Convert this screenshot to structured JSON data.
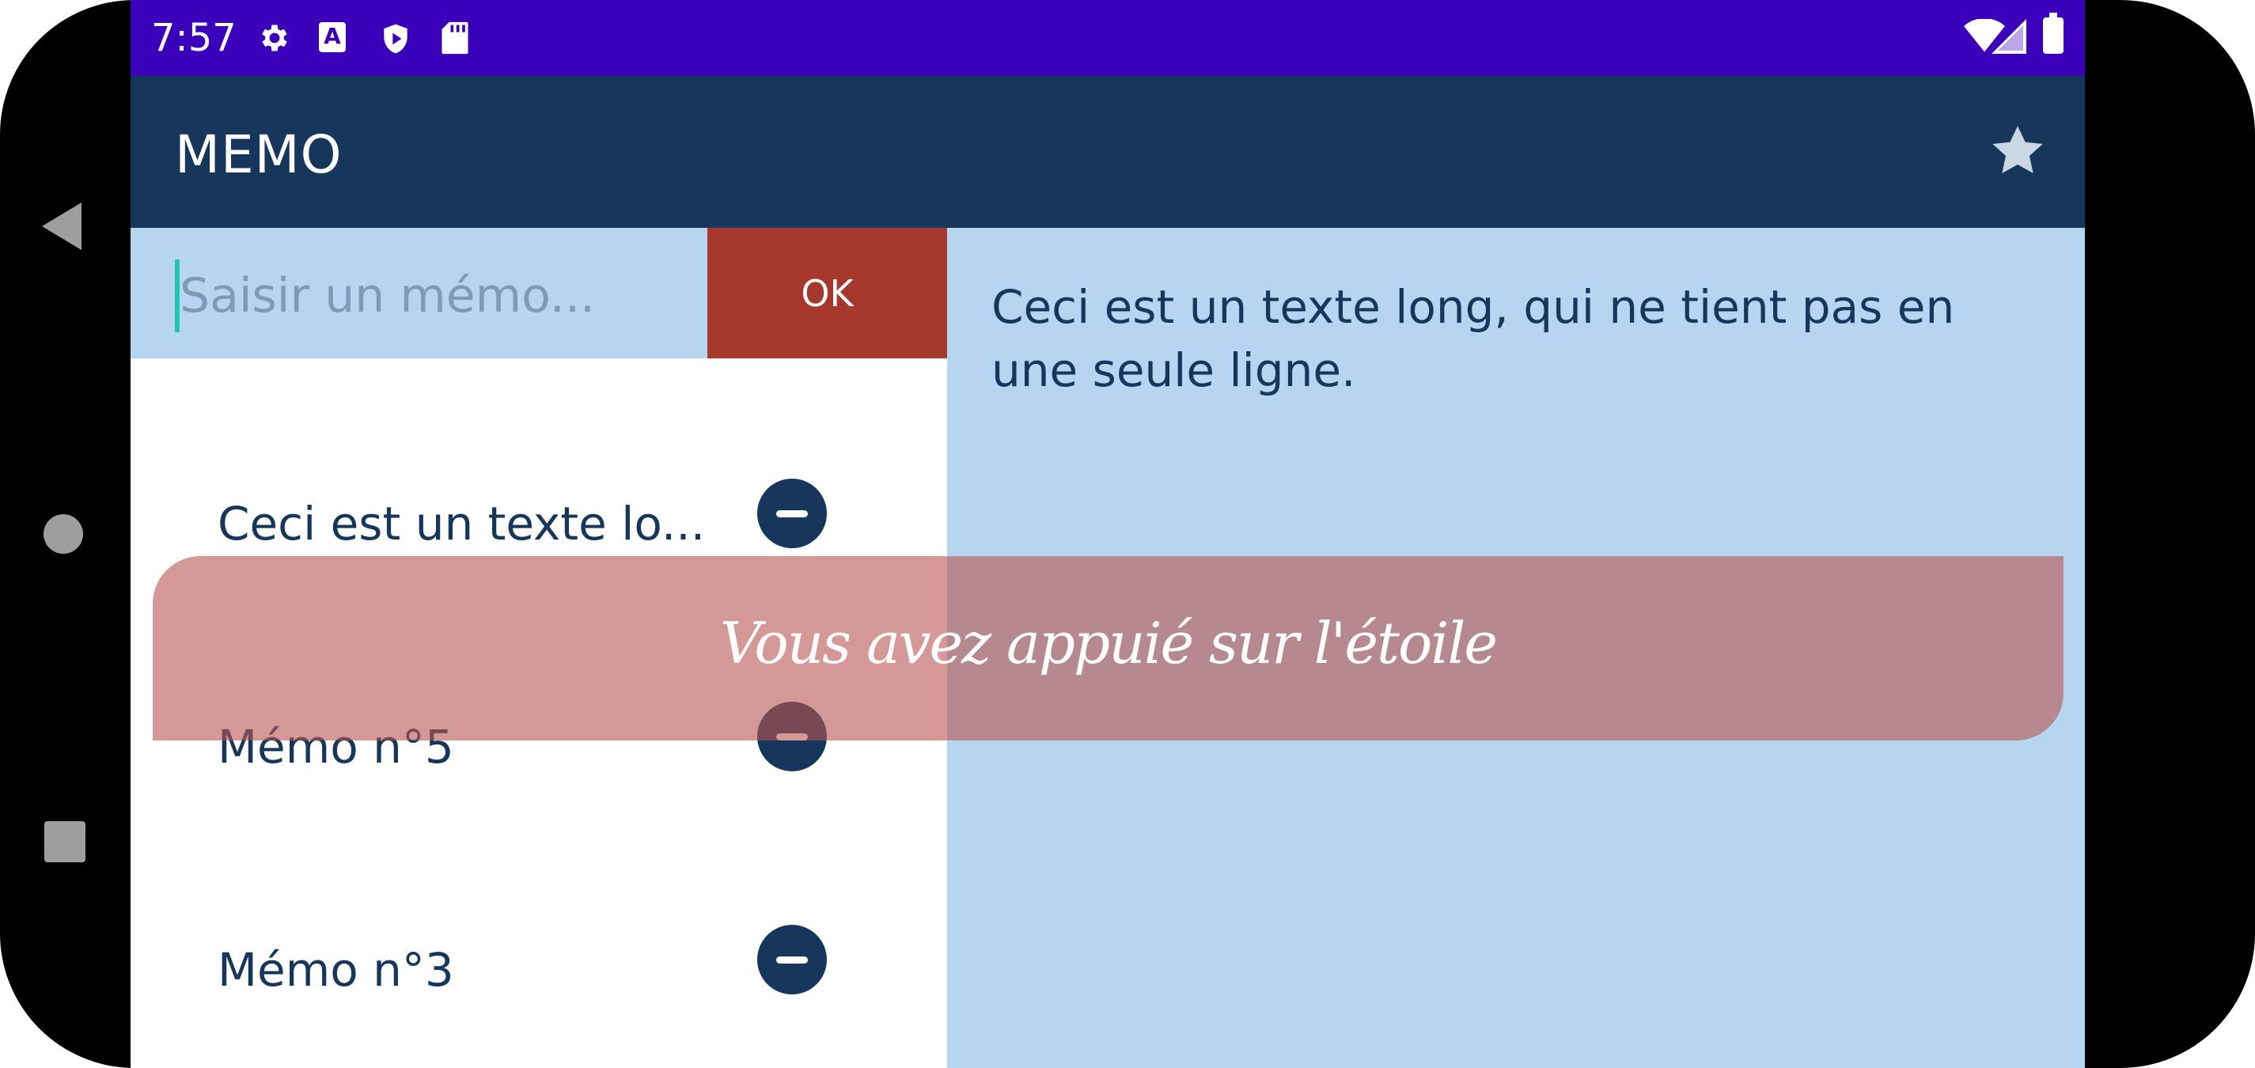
{
  "status_bar": {
    "time": "7:57",
    "icons": [
      "settings-icon",
      "keyboard-a-icon",
      "shield-play-icon",
      "sd-card-icon",
      "wifi-icon",
      "cell-signal-icon",
      "battery-icon"
    ],
    "keyboard_letter": "A",
    "color": "#3b00b9"
  },
  "app_bar": {
    "title": "MEMO",
    "action_icon": "star-icon",
    "color": "#16375b"
  },
  "input": {
    "placeholder": "Saisir un mémo...",
    "value": "",
    "ok_label": "OK"
  },
  "memos": [
    {
      "text": "Ceci est un texte lo..."
    },
    {
      "text": "Mémo n°5"
    },
    {
      "text": "Mémo n°3"
    }
  ],
  "detail": {
    "text": "Ceci est un texte long, qui ne tient pas en une seule ligne."
  },
  "toast": {
    "message": "Vous avez appuié sur l'étoile"
  },
  "colors": {
    "accent": "#a5372c",
    "panel": "#b5d5f1",
    "primary": "#16375b"
  }
}
